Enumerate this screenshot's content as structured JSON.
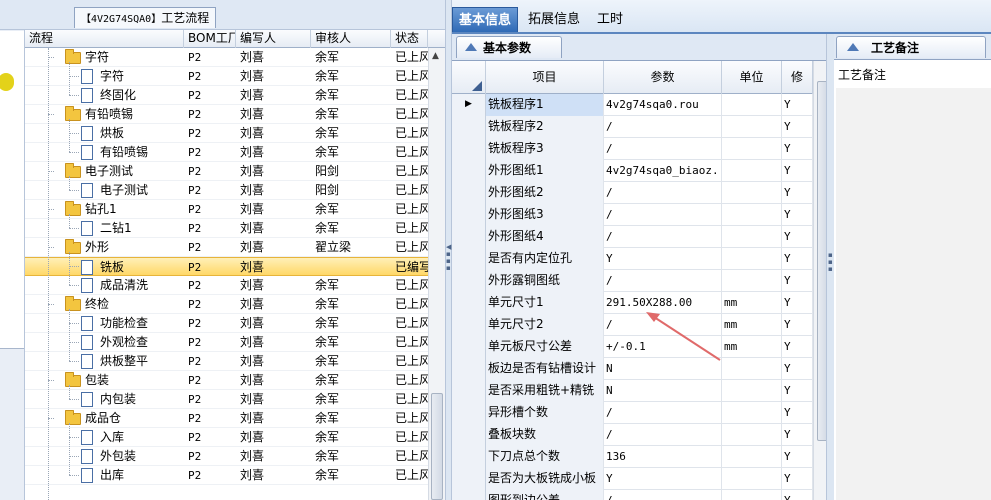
{
  "header_tab": {
    "code": "【4V2G74SQA0】",
    "label": "工艺流程"
  },
  "tree_grid": {
    "columns": [
      "流程",
      "BOM工厂",
      "编写人",
      "审核人",
      "状态"
    ],
    "rows": [
      {
        "name": "字符",
        "folder": true,
        "factory": "P2",
        "author": "刘喜",
        "reviewer": "余军",
        "status": "已上风"
      },
      {
        "name": "字符",
        "folder": false,
        "factory": "P2",
        "author": "刘喜",
        "reviewer": "余军",
        "status": "已上风"
      },
      {
        "name": "终固化",
        "folder": false,
        "factory": "P2",
        "author": "刘喜",
        "reviewer": "余军",
        "status": "已上风"
      },
      {
        "name": "有铅喷锡",
        "folder": true,
        "factory": "P2",
        "author": "刘喜",
        "reviewer": "余军",
        "status": "已上风"
      },
      {
        "name": "烘板",
        "folder": false,
        "factory": "P2",
        "author": "刘喜",
        "reviewer": "余军",
        "status": "已上风"
      },
      {
        "name": "有铅喷锡",
        "folder": false,
        "factory": "P2",
        "author": "刘喜",
        "reviewer": "余军",
        "status": "已上风"
      },
      {
        "name": "电子测试",
        "folder": true,
        "factory": "P2",
        "author": "刘喜",
        "reviewer": "阳剑",
        "status": "已上风"
      },
      {
        "name": "电子测试",
        "folder": false,
        "factory": "P2",
        "author": "刘喜",
        "reviewer": "阳剑",
        "status": "已上风"
      },
      {
        "name": "钻孔1",
        "folder": true,
        "factory": "P2",
        "author": "刘喜",
        "reviewer": "余军",
        "status": "已上风"
      },
      {
        "name": "二钻1",
        "folder": false,
        "factory": "P2",
        "author": "刘喜",
        "reviewer": "余军",
        "status": "已上风"
      },
      {
        "name": "外形",
        "folder": true,
        "factory": "P2",
        "author": "刘喜",
        "reviewer": "翟立梁",
        "status": "已上风"
      },
      {
        "name": "铣板",
        "folder": false,
        "factory": "P2",
        "author": "刘喜",
        "reviewer": "",
        "status": "已编写"
      },
      {
        "name": "成品清洗",
        "folder": false,
        "factory": "P2",
        "author": "刘喜",
        "reviewer": "余军",
        "status": "已上风"
      },
      {
        "name": "终检",
        "folder": true,
        "factory": "P2",
        "author": "刘喜",
        "reviewer": "余军",
        "status": "已上风"
      },
      {
        "name": "功能检查",
        "folder": false,
        "factory": "P2",
        "author": "刘喜",
        "reviewer": "余军",
        "status": "已上风"
      },
      {
        "name": "外观检查",
        "folder": false,
        "factory": "P2",
        "author": "刘喜",
        "reviewer": "余军",
        "status": "已上风"
      },
      {
        "name": "烘板整平",
        "folder": false,
        "factory": "P2",
        "author": "刘喜",
        "reviewer": "余军",
        "status": "已上风"
      },
      {
        "name": "包装",
        "folder": true,
        "factory": "P2",
        "author": "刘喜",
        "reviewer": "余军",
        "status": "已上风"
      },
      {
        "name": "内包装",
        "folder": false,
        "factory": "P2",
        "author": "刘喜",
        "reviewer": "余军",
        "status": "已上风"
      },
      {
        "name": "成品仓",
        "folder": true,
        "factory": "P2",
        "author": "刘喜",
        "reviewer": "余军",
        "status": "已上风"
      },
      {
        "name": "入库",
        "folder": false,
        "factory": "P2",
        "author": "刘喜",
        "reviewer": "余军",
        "status": "已上风"
      },
      {
        "name": "外包装",
        "folder": false,
        "factory": "P2",
        "author": "刘喜",
        "reviewer": "余军",
        "status": "已上风"
      },
      {
        "name": "出库",
        "folder": false,
        "factory": "P2",
        "author": "刘喜",
        "reviewer": "余军",
        "status": "已上风"
      }
    ]
  },
  "main_tabs": [
    "基本信息",
    "拓展信息",
    "工时"
  ],
  "params_panel": {
    "tab_label": "基本参数",
    "columns": [
      "项目",
      "参数",
      "单位",
      "修"
    ],
    "rows": [
      {
        "item": "铣板程序1",
        "value": "4v2g74sqa0.rou",
        "unit": "",
        "flag": "Y"
      },
      {
        "item": "铣板程序2",
        "value": "/",
        "unit": "",
        "flag": "Y"
      },
      {
        "item": "铣板程序3",
        "value": "/",
        "unit": "",
        "flag": "Y"
      },
      {
        "item": "外形图纸1",
        "value": "4v2g74sqa0_biaoz...",
        "unit": "",
        "flag": "Y"
      },
      {
        "item": "外形图纸2",
        "value": "/",
        "unit": "",
        "flag": "Y"
      },
      {
        "item": "外形图纸3",
        "value": "/",
        "unit": "",
        "flag": "Y"
      },
      {
        "item": "外形图纸4",
        "value": "/",
        "unit": "",
        "flag": "Y"
      },
      {
        "item": "是否有内定位孔",
        "value": "Y",
        "unit": "",
        "flag": "Y"
      },
      {
        "item": "外形露铜图纸",
        "value": "/",
        "unit": "",
        "flag": "Y"
      },
      {
        "item": "单元尺寸1",
        "value": "291.50X288.00",
        "unit": "mm",
        "flag": "Y"
      },
      {
        "item": "单元尺寸2",
        "value": "/",
        "unit": "mm",
        "flag": "Y"
      },
      {
        "item": "单元板尺寸公差",
        "value": "+/-0.1",
        "unit": "mm",
        "flag": "Y"
      },
      {
        "item": "板边是否有钻槽设计",
        "value": "N",
        "unit": "",
        "flag": "Y"
      },
      {
        "item": "是否采用粗铣+精铣",
        "value": "N",
        "unit": "",
        "flag": "Y"
      },
      {
        "item": "异形槽个数",
        "value": "/",
        "unit": "",
        "flag": "Y"
      },
      {
        "item": "叠板块数",
        "value": "/",
        "unit": "",
        "flag": "Y"
      },
      {
        "item": "下刀点总个数",
        "value": "136",
        "unit": "",
        "flag": "Y"
      },
      {
        "item": "是否为大板铣成小板",
        "value": "Y",
        "unit": "",
        "flag": "Y"
      },
      {
        "item": "图形到边公差",
        "value": "/",
        "unit": "",
        "flag": "Y"
      }
    ]
  },
  "notes_panel": {
    "tab_label": "工艺备注",
    "label": "工艺备注"
  },
  "colors": {
    "accent": "#2f6ab6",
    "selected_row": "#ffd868",
    "annotation_arrow": "#e06a6a"
  }
}
